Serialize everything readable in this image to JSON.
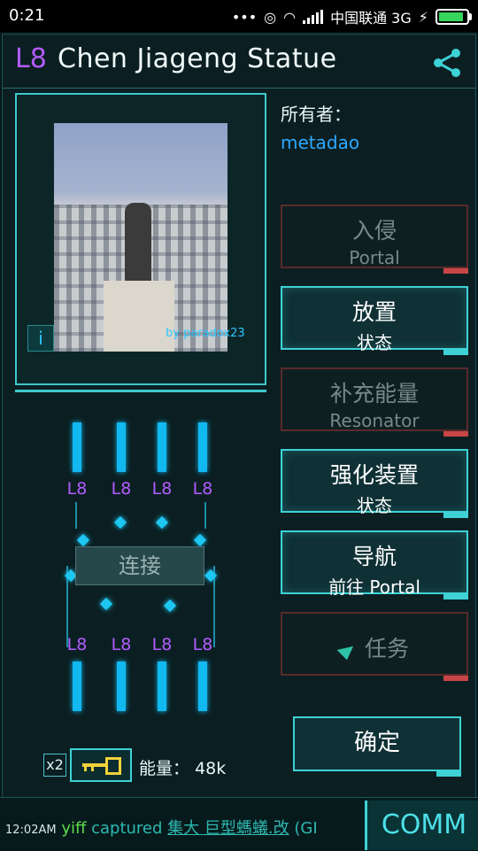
{
  "status": {
    "time": "0:21",
    "carrier": "中国联通 3G",
    "battery_level": 0.95
  },
  "portal": {
    "level": "L8",
    "name": "Chen Jiageng Statue",
    "photo_credit": "by paradox23"
  },
  "owner": {
    "label": "所有者：",
    "name": "metadao"
  },
  "actions": [
    {
      "title": "入侵",
      "subtitle": "Portal",
      "enabled": false
    },
    {
      "title": "放置",
      "subtitle": "状态",
      "enabled": true
    },
    {
      "title": "补充能量",
      "subtitle": "Resonator",
      "enabled": false
    },
    {
      "title": "强化装置",
      "subtitle": "状态",
      "enabled": true
    },
    {
      "title": "导航",
      "subtitle": "前往 Portal",
      "enabled": true
    },
    {
      "title": "任务",
      "enabled": false
    }
  ],
  "confirm_label": "确定",
  "resonators": {
    "top": [
      "L8",
      "L8",
      "L8",
      "L8"
    ],
    "bottom": [
      "L8",
      "L8",
      "L8",
      "L8"
    ]
  },
  "link_label": "连接",
  "keys": {
    "count": "x2"
  },
  "energy": {
    "label": "能量：",
    "value": "48k"
  },
  "comm": {
    "timestamp": "12:02AM",
    "agent": "yiff",
    "verb": "captured",
    "portal": "集大 巨型螞蟻.改",
    "rest": "(GI",
    "button": "COMM"
  },
  "colors": {
    "accent": "#3ed2d6",
    "level": "#b35cff",
    "owner": "#2ea8ff",
    "disabled_border": "#c84646"
  }
}
